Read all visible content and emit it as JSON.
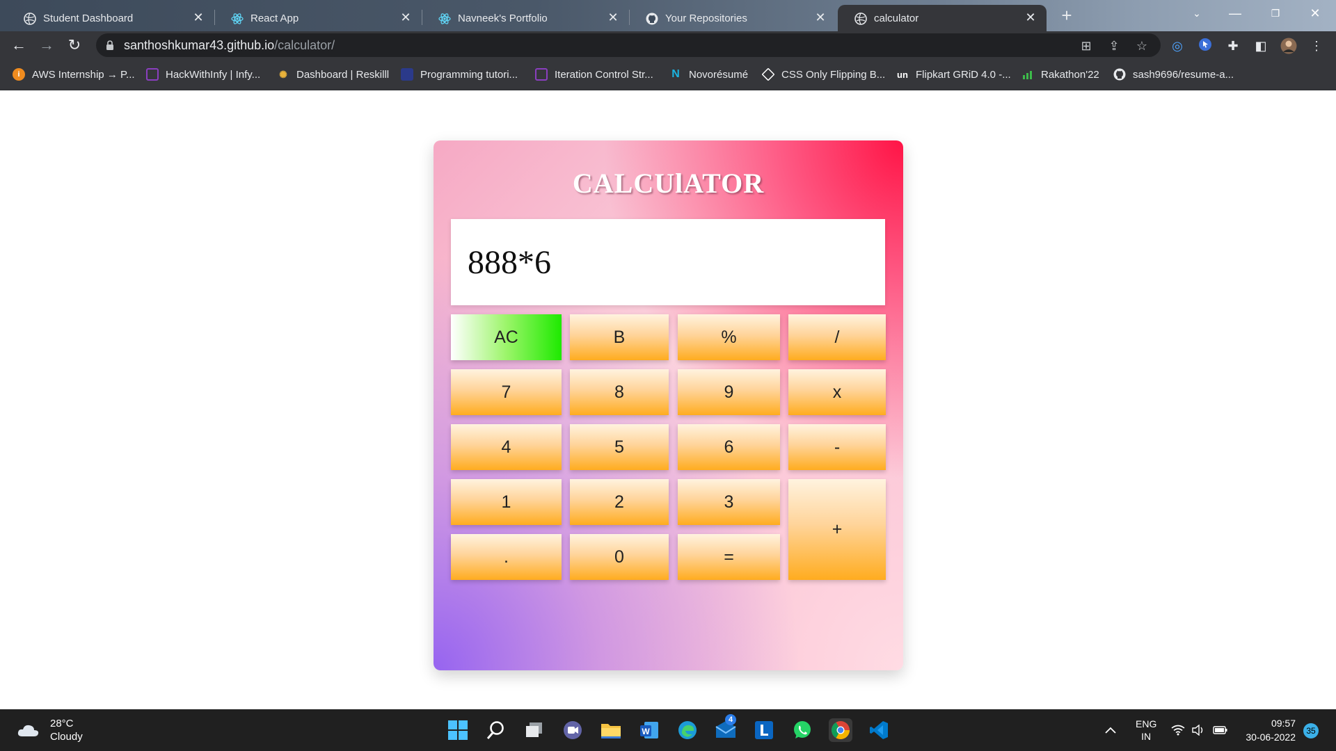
{
  "browser": {
    "tabs": [
      {
        "label": "Student Dashboard",
        "icon": "globe-icon"
      },
      {
        "label": "React App",
        "icon": "react-icon"
      },
      {
        "label": "Navneek's Portfolio",
        "icon": "react-icon"
      },
      {
        "label": "Your Repositories",
        "icon": "github-icon"
      },
      {
        "label": "calculator",
        "icon": "globe-icon",
        "active": true
      }
    ],
    "close_glyph": "✕",
    "new_tab_glyph": "+",
    "url_host": "santhoshkumar43.github.io",
    "url_path": "/calculator/",
    "bookmarks": [
      {
        "label": "AWS Internship → P...",
        "icon": "aws-icon",
        "color": "#f08c1f"
      },
      {
        "label": "HackWithInfy | Infy...",
        "icon": "hackwithinfy-icon",
        "color": "#8a3fbf"
      },
      {
        "label": "Dashboard | Reskilll",
        "icon": "bulb-icon",
        "color": "#e8b23a"
      },
      {
        "label": "Programming tutori...",
        "icon": "tutorial-icon",
        "color": "#2b3a8a"
      },
      {
        "label": "Iteration Control Str...",
        "icon": "iteration-icon",
        "color": "#8a3fbf"
      },
      {
        "label": "Novorésumé",
        "icon": "novoresume-icon",
        "color": "#1bb4e0"
      },
      {
        "label": "CSS Only Flipping B...",
        "icon": "codepen-icon",
        "color": "#ffffff"
      },
      {
        "label": "Flipkart GRiD 4.0 -...",
        "icon": "unstop-icon",
        "color": "#1a5bd8"
      },
      {
        "label": "Rakathon'22",
        "icon": "rakathon-icon",
        "color": "#3dbb4a"
      },
      {
        "label": "sash9696/resume-a...",
        "icon": "github-icon",
        "color": "#ffffff"
      }
    ]
  },
  "calculator": {
    "title": "CALCUlATOR",
    "display": "888*6",
    "keys": {
      "ac": "AC",
      "back": "B",
      "percent": "%",
      "divide": "/",
      "seven": "7",
      "eight": "8",
      "nine": "9",
      "multiply": "x",
      "four": "4",
      "five": "5",
      "six": "6",
      "minus": "-",
      "one": "1",
      "two": "2",
      "three": "3",
      "plus": "+",
      "dot": ".",
      "zero": "0",
      "equals": "="
    }
  },
  "taskbar": {
    "weather_temp": "28°C",
    "weather_desc": "Cloudy",
    "mail_badge": "4",
    "language_top": "ENG",
    "language_bottom": "IN",
    "time": "09:57",
    "date": "30-06-2022",
    "notifications": "35"
  }
}
